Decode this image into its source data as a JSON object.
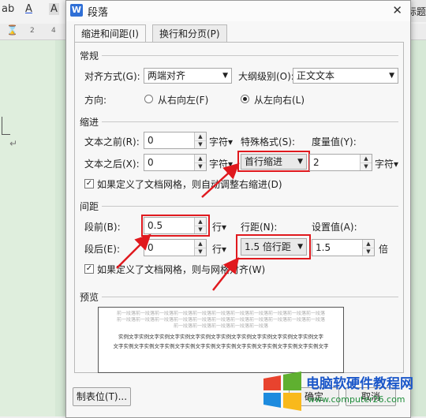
{
  "background": {
    "toolbar_font_a": "A",
    "toolbar_font_a2": "A",
    "toolbar_ab": "ab",
    "right_tab_label": "标题",
    "ruler_labels": [
      "2",
      "4"
    ],
    "pilcrow": "↵"
  },
  "dialog": {
    "title": "段落",
    "app_icon_letter": "W",
    "close_label": "✕",
    "tabs": [
      {
        "label": "缩进和间距(I)",
        "active": true
      },
      {
        "label": "换行和分页(P)",
        "active": false
      }
    ],
    "general": {
      "section_title": "常规",
      "alignment_label": "对齐方式(G):",
      "alignment_value": "两端对齐",
      "outline_label": "大纲级别(O):",
      "outline_value": "正文文本",
      "direction_label": "方向:",
      "rtl_label": "从右向左(F)",
      "ltr_label": "从左向右(L)",
      "rtl_selected": false,
      "ltr_selected": true
    },
    "indent": {
      "section_title": "缩进",
      "before_label": "文本之前(R):",
      "before_value": "0",
      "before_unit": "字符▾",
      "after_label": "文本之后(X):",
      "after_value": "0",
      "after_unit": "字符▾",
      "special_label": "特殊格式(S):",
      "special_value": "首行缩进",
      "measure_label": "度量值(Y):",
      "measure_value": "2",
      "measure_unit": "字符▾",
      "grid_check_label": "如果定义了文档网格，则自动调整右缩进(D)",
      "grid_checked": true
    },
    "spacing": {
      "section_title": "间距",
      "before_label": "段前(B):",
      "before_value": "0.5",
      "before_unit": "行▾",
      "after_label": "段后(E):",
      "after_value": "0",
      "after_unit": "行▾",
      "line_label": "行距(N):",
      "line_value": "1.5 倍行距",
      "set_label": "设置值(A):",
      "set_value": "1.5",
      "set_unit": "倍",
      "grid_check_label": "如果定义了文档网格，则与网格对齐(W)",
      "grid_checked": true
    },
    "preview": {
      "section_title": "预览",
      "prev_lines": [
        "前一段落前一段落前一段落前一段落前一段落前一段落前一段落前一段落前一段落前一段落前一段落",
        "前一段落前一段落前一段落前一段落前一段落前一段落前一段落前一段落前一段落前一段落前一段落",
        "前一段落前一段落前一段落前一段落前一段落"
      ],
      "sample_lines": [
        "实例文字实例文字实例文字实例文字实例文字实例文字实例文字实例文字实例文字实例文字",
        "文字实例文字实例文字实例文字实例文字实例文字实例文字实例文字实例文字实例文字实例文字"
      ]
    },
    "tabs_button": "制表位(T)...",
    "ok_button": "确定",
    "cancel_button": "取消"
  },
  "watermark": {
    "text": "电脑软硬件教程网",
    "url": "www.computer26.com"
  },
  "colors": {
    "highlight": "#e0191e",
    "accent": "#2f6fd6"
  }
}
